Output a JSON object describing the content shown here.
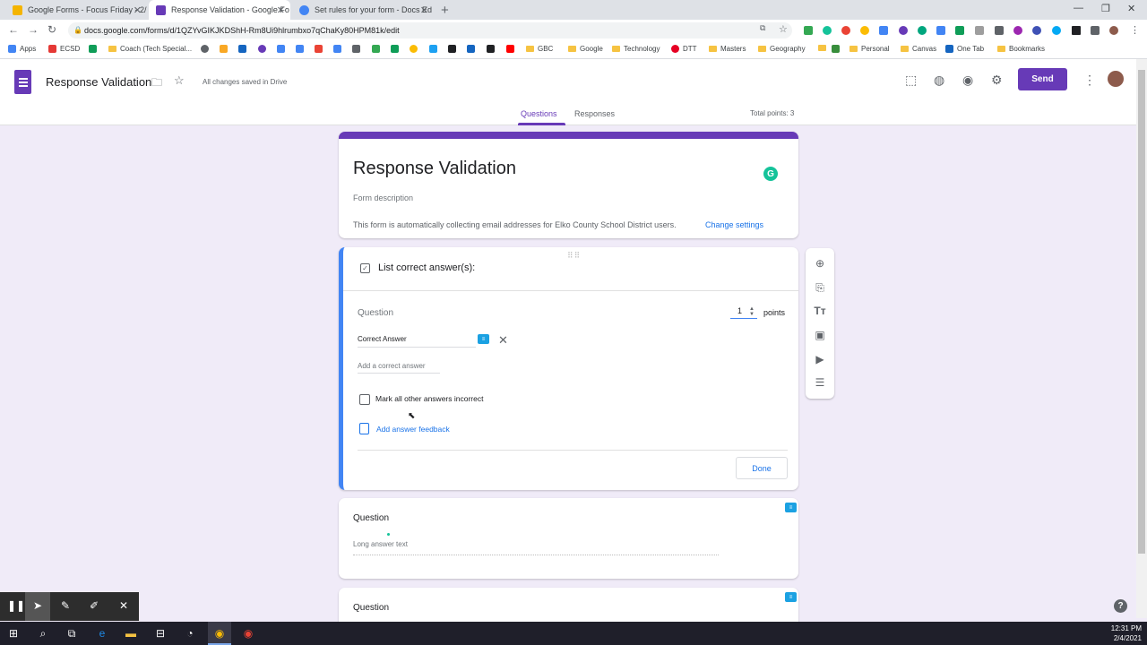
{
  "browser": {
    "tabs": [
      {
        "title": "Google Forms - Focus Friday - 2/",
        "favicon_color": "#f4b400"
      },
      {
        "title": "Response Validation - Google Fo",
        "favicon_color": "#673ab7"
      },
      {
        "title": "Set rules for your form - Docs Ed",
        "favicon_color": "#4285f4"
      }
    ],
    "url": "docs.google.com/forms/d/1QZYvGIKJKDShH-Rm8Ui9hlrumbxo7qChaKy80HPM81k/edit",
    "bookmarks": [
      "Apps",
      "ECSD",
      "Coach (Tech Special...",
      "GBC",
      "Google",
      "Technology",
      "DTT",
      "Masters",
      "Geography",
      "Personal",
      "Canvas",
      "One Tab",
      "Bookmarks"
    ]
  },
  "header": {
    "doc_title": "Response Validation",
    "saved_status": "All changes saved in Drive",
    "send_label": "Send",
    "accent": "#673ab7"
  },
  "nav": {
    "questions": "Questions",
    "responses": "Responses",
    "total_points": "Total points: 3"
  },
  "title_card": {
    "title": "Response Validation",
    "description_placeholder": "Form description",
    "collect_note": "This form is automatically collecting email addresses for Elko County School District users.",
    "change_settings": "Change settings"
  },
  "answer_key": {
    "header": "List correct answer(s):",
    "question": "Question",
    "points_value": "1",
    "points_label": "points",
    "correct_answer": "Correct Answer",
    "add_placeholder": "Add a correct answer",
    "mark_incorrect_label": "Mark all other answers incorrect",
    "feedback_link": "Add answer feedback",
    "done_label": "Done"
  },
  "question2": {
    "title": "Question",
    "answer_placeholder": "Long answer text"
  },
  "question3": {
    "title": "Question"
  },
  "taskbar": {
    "time": "12:31 PM",
    "date": "2/4/2021"
  }
}
